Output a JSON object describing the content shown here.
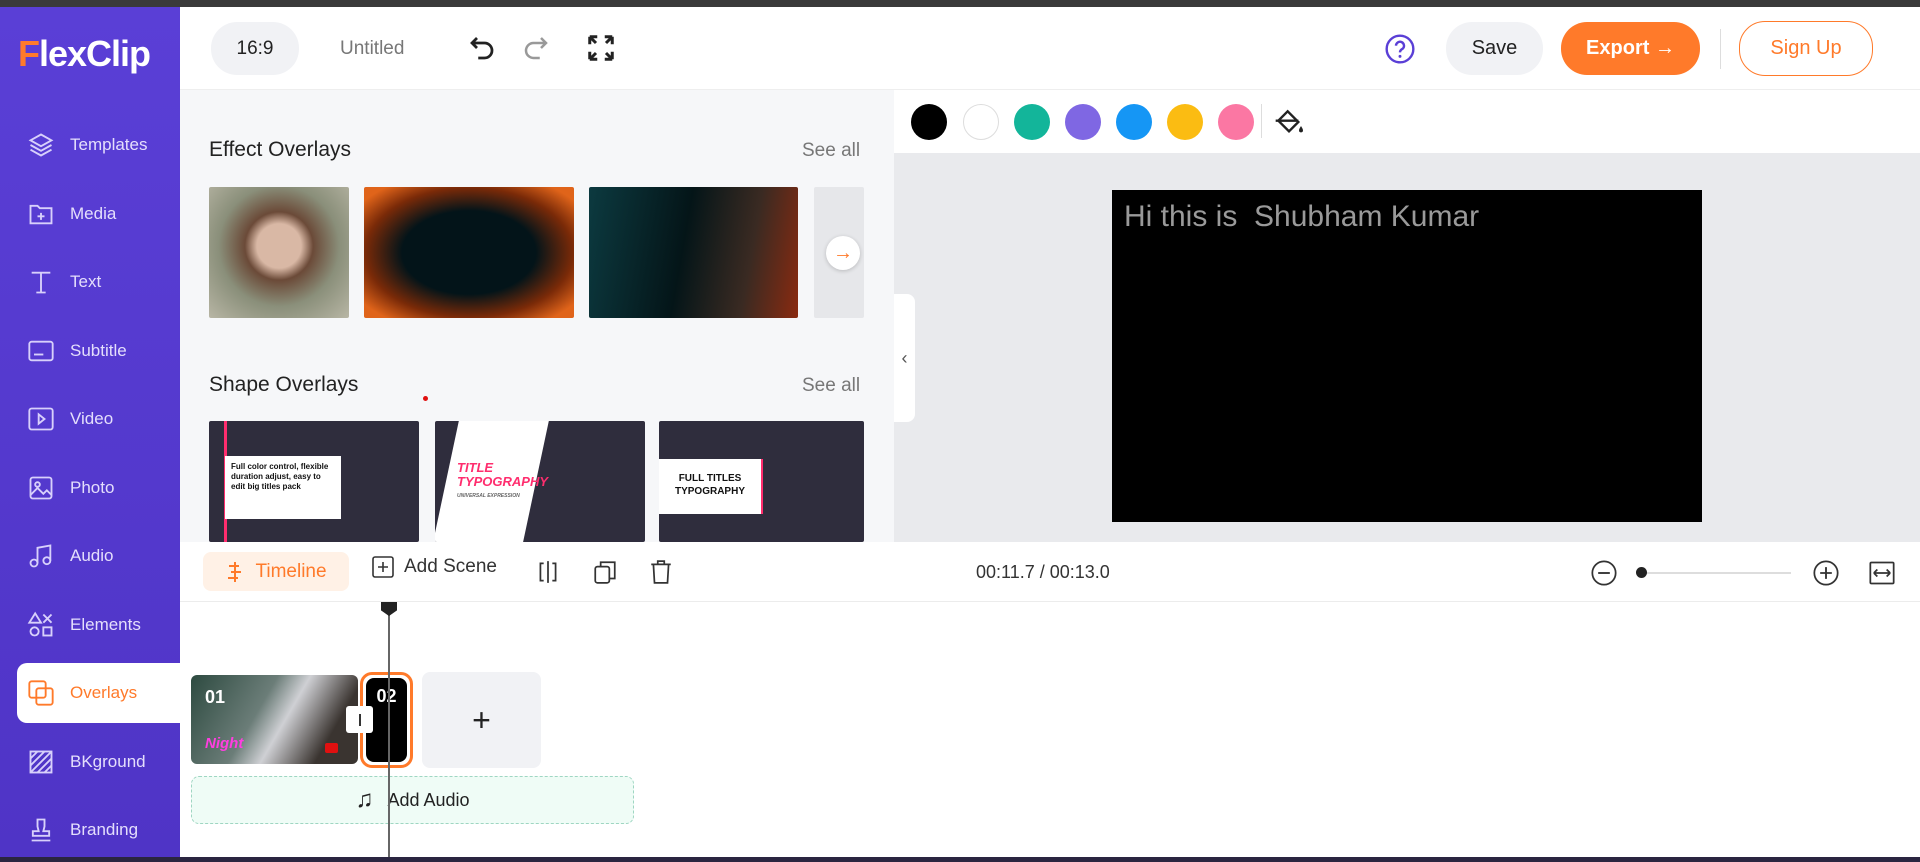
{
  "app": {
    "logo": "FlexClip",
    "logo_first": "F",
    "logo_rest": "lexClip"
  },
  "sidebar": {
    "items": [
      {
        "label": "Templates",
        "icon": "layers-icon"
      },
      {
        "label": "Media",
        "icon": "folder-plus-icon"
      },
      {
        "label": "Text",
        "icon": "text-icon"
      },
      {
        "label": "Subtitle",
        "icon": "subtitle-icon"
      },
      {
        "label": "Video",
        "icon": "video-icon"
      },
      {
        "label": "Photo",
        "icon": "photo-icon"
      },
      {
        "label": "Audio",
        "icon": "music-icon"
      },
      {
        "label": "Elements",
        "icon": "elements-icon"
      },
      {
        "label": "Overlays",
        "icon": "overlays-icon",
        "active": true
      },
      {
        "label": "BKground",
        "icon": "background-icon"
      },
      {
        "label": "Branding",
        "icon": "stamp-icon"
      }
    ]
  },
  "header": {
    "aspect": "16:9",
    "title": "Untitled",
    "save": "Save",
    "export": "Export →",
    "signup": "Sign Up"
  },
  "panel": {
    "effect": {
      "title": "Effect Overlays",
      "see_all": "See all"
    },
    "shape": {
      "title": "Shape Overlays",
      "see_all": "See all",
      "thumbs": [
        {
          "text": "Full color control, flexible duration adjust, easy to edit big titles pack"
        },
        {
          "text1": "TITLE",
          "text2": "TYPOGRAPHY",
          "sub": "UNIVERSAL EXPRESSION"
        },
        {
          "text1": "FULL TITLES",
          "text2": "TYPOGRAPHY"
        }
      ]
    }
  },
  "colors": [
    "#000000",
    "#ffffff",
    "#13b59a",
    "#7f67e3",
    "#1596f5",
    "#fbbc12",
    "#fb77a3"
  ],
  "accent": "#ff7a2a",
  "brand": "#5a3fd6",
  "canvas": {
    "text": "Hi this is  Shubham Kumar"
  },
  "toolbar": {
    "timeline": "Timeline",
    "add_scene": "Add Scene",
    "time": "00:11.7 / 00:13.0"
  },
  "timeline": {
    "clips": [
      {
        "label": "01",
        "overlay": "Night"
      },
      {
        "label": "02"
      }
    ],
    "add": "+",
    "add_audio": "Add Audio"
  }
}
